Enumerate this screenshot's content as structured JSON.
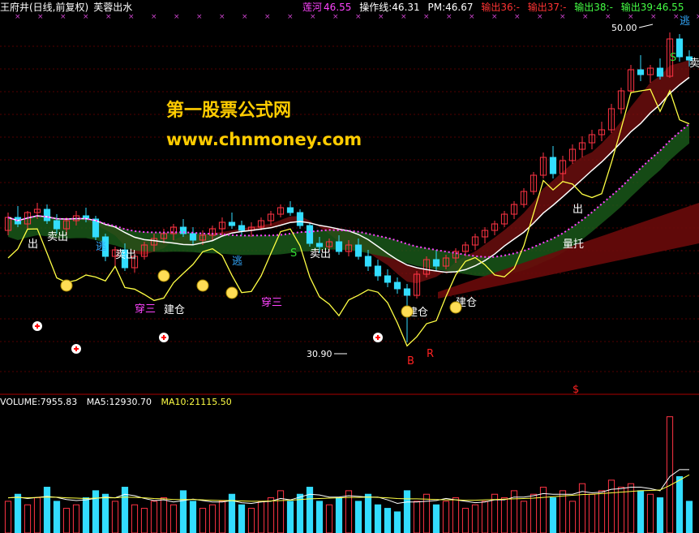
{
  "header": {
    "title": "王府井(日线,前复权)",
    "indicator": "芙蓉出水",
    "l1_name": "莲河",
    "l1_val": "46.55",
    "l2_name": "操作线",
    "l2_val": "46.31",
    "l3_name": "PM",
    "l3_val": "46.67",
    "l4": "输出36:-",
    "l5": "输出37:-",
    "l6": "输出38:-",
    "l7_name": "输出39",
    "l7_val": "46.55"
  },
  "watermark": {
    "line1": "第一股票公式网",
    "line2": "www.chnmoney.com"
  },
  "volume_panel": {
    "vol_label": "VOLUME:7955.83",
    "ma5_label": "MA5:12930.70",
    "ma10_label": "MA10:21115.50"
  },
  "colors": {
    "up": "#ff3344",
    "down": "#33ddff",
    "white_line": "#ffffff",
    "yellow_line": "#ffff44",
    "green_band": "#1a5c1a",
    "red_band": "#7a1010",
    "magenta_dots": "#ff44ff",
    "vol_ma": "#ffffff"
  },
  "chart_data": [
    {
      "type": "candlestick",
      "title": "王府井(日线,前复权)",
      "price_labels": {
        "high": "50.00",
        "low": "30.90"
      },
      "annotations": [
        "出",
        "卖出",
        "逃",
        "卖出",
        "穿三",
        "建仓",
        "逃",
        "穿三",
        "S",
        "卖出",
        "建仓",
        "建仓",
        "B",
        "R",
        "出",
        "量托",
        "逃",
        "卖出",
        "S",
        "$"
      ],
      "candles": [
        [
          37.8,
          38.9,
          37.5,
          38.6
        ],
        [
          38.6,
          39.3,
          38.0,
          38.2
        ],
        [
          38.2,
          39.0,
          37.9,
          38.9
        ],
        [
          38.9,
          39.5,
          38.5,
          39.1
        ],
        [
          39.1,
          39.4,
          38.2,
          38.4
        ],
        [
          38.4,
          38.8,
          37.6,
          37.9
        ],
        [
          37.9,
          38.6,
          37.5,
          38.4
        ],
        [
          38.4,
          39.0,
          38.1,
          38.7
        ],
        [
          38.7,
          39.2,
          38.3,
          38.5
        ],
        [
          38.5,
          38.7,
          37.2,
          37.4
        ],
        [
          37.4,
          37.6,
          35.9,
          36.2
        ],
        [
          36.2,
          36.8,
          35.5,
          36.6
        ],
        [
          36.6,
          37.0,
          35.3,
          35.5
        ],
        [
          35.5,
          36.4,
          35.2,
          36.2
        ],
        [
          36.2,
          37.1,
          36.0,
          36.9
        ],
        [
          36.9,
          37.6,
          36.5,
          37.3
        ],
        [
          37.3,
          37.9,
          37.0,
          37.6
        ],
        [
          37.6,
          38.2,
          37.2,
          38.0
        ],
        [
          38.0,
          38.5,
          37.4,
          37.6
        ],
        [
          37.6,
          38.0,
          36.9,
          37.2
        ],
        [
          37.2,
          37.8,
          36.9,
          37.5
        ],
        [
          37.5,
          38.1,
          37.2,
          37.9
        ],
        [
          37.9,
          38.6,
          37.5,
          38.3
        ],
        [
          38.3,
          38.9,
          37.9,
          38.1
        ],
        [
          38.1,
          38.4,
          37.5,
          37.8
        ],
        [
          37.8,
          38.3,
          37.4,
          38.0
        ],
        [
          38.0,
          38.6,
          37.8,
          38.4
        ],
        [
          38.4,
          39.0,
          38.1,
          38.8
        ],
        [
          38.8,
          39.4,
          38.6,
          39.2
        ],
        [
          39.2,
          39.6,
          38.7,
          38.9
        ],
        [
          38.9,
          39.1,
          37.9,
          38.1
        ],
        [
          38.1,
          38.3,
          36.8,
          37.0
        ],
        [
          37.0,
          37.4,
          36.4,
          36.8
        ],
        [
          36.8,
          37.3,
          36.5,
          37.1
        ],
        [
          37.1,
          37.5,
          36.3,
          36.5
        ],
        [
          36.5,
          37.2,
          36.2,
          36.9
        ],
        [
          36.9,
          37.3,
          36.0,
          36.2
        ],
        [
          36.2,
          36.6,
          35.3,
          35.6
        ],
        [
          35.6,
          36.0,
          34.7,
          35.0
        ],
        [
          35.0,
          35.4,
          34.3,
          34.6
        ],
        [
          34.6,
          34.9,
          33.9,
          34.2
        ],
        [
          34.2,
          34.5,
          30.9,
          33.8
        ],
        [
          33.8,
          35.3,
          33.6,
          35.1
        ],
        [
          35.1,
          36.2,
          34.9,
          36.0
        ],
        [
          36.0,
          36.6,
          35.3,
          35.6
        ],
        [
          35.6,
          36.3,
          35.4,
          36.1
        ],
        [
          36.1,
          36.7,
          35.8,
          36.5
        ],
        [
          36.5,
          37.1,
          36.2,
          36.9
        ],
        [
          36.9,
          37.6,
          36.6,
          37.4
        ],
        [
          37.4,
          38.0,
          37.0,
          37.8
        ],
        [
          37.8,
          38.4,
          37.5,
          38.2
        ],
        [
          38.2,
          39.0,
          38.0,
          38.8
        ],
        [
          38.8,
          39.6,
          38.5,
          39.4
        ],
        [
          39.4,
          40.4,
          39.2,
          40.2
        ],
        [
          40.2,
          41.4,
          40.0,
          41.2
        ],
        [
          41.2,
          42.6,
          41.0,
          42.3
        ],
        [
          42.3,
          43.0,
          41.0,
          41.3
        ],
        [
          41.3,
          42.4,
          40.8,
          42.1
        ],
        [
          42.1,
          43.1,
          41.9,
          42.8
        ],
        [
          42.8,
          43.6,
          42.3,
          43.2
        ],
        [
          43.2,
          44.0,
          42.8,
          43.7
        ],
        [
          43.7,
          44.5,
          43.3,
          44.0
        ],
        [
          44.0,
          45.6,
          43.8,
          45.3
        ],
        [
          45.3,
          46.6,
          45.0,
          46.4
        ],
        [
          46.4,
          48.0,
          46.2,
          47.7
        ],
        [
          47.7,
          48.6,
          47.0,
          47.4
        ],
        [
          47.4,
          48.0,
          46.9,
          47.8
        ],
        [
          47.8,
          48.4,
          47.1,
          47.3
        ],
        [
          47.3,
          50.0,
          47.2,
          49.6
        ],
        [
          49.6,
          49.9,
          48.2,
          48.5
        ],
        [
          48.5,
          48.9,
          47.9,
          48.3
        ]
      ],
      "volume": {
        "max": 35000,
        "values": [
          9000,
          11000,
          8000,
          10000,
          13000,
          9000,
          7000,
          8000,
          10000,
          12000,
          11000,
          9000,
          13000,
          8000,
          7000,
          9000,
          10000,
          8000,
          12000,
          9000,
          7000,
          8000,
          9000,
          11000,
          8000,
          7000,
          9000,
          10000,
          12000,
          9000,
          11000,
          13000,
          9000,
          8000,
          10000,
          12000,
          9000,
          11000,
          8000,
          7000,
          6000,
          12000,
          9000,
          11000,
          8000,
          9000,
          10000,
          7000,
          8000,
          9000,
          11000,
          10000,
          12000,
          9000,
          11000,
          13000,
          10000,
          12000,
          9000,
          14000,
          11000,
          12000,
          15000,
          13000,
          14000,
          12000,
          11000,
          10000,
          33000,
          16000,
          9000
        ],
        "ma5": [
          10000,
          10200,
          9800,
          10100,
          10400,
          10100,
          9500,
          9200,
          9400,
          9800,
          10200,
          10000,
          11000,
          10600,
          9800,
          9200,
          9400,
          8800,
          9200,
          9600,
          9200,
          8800,
          8800,
          9200,
          8600,
          8400,
          8800,
          9000,
          9800,
          9400,
          10200,
          11000,
          10800,
          10200,
          10200,
          10600,
          10400,
          10200,
          10200,
          9400,
          8400,
          8800,
          8800,
          9000,
          9200,
          9800,
          9400,
          9000,
          8600,
          8800,
          9400,
          9400,
          10200,
          10200,
          10600,
          11200,
          11000,
          11000,
          11000,
          11800,
          11400,
          11600,
          12400,
          12600,
          13000,
          13000,
          12600,
          12000,
          16000,
          18000,
          18000
        ],
        "ma10": [
          10000,
          10100,
          10000,
          10100,
          10200,
          10150,
          10000,
          9900,
          9800,
          9900,
          10000,
          10000,
          10200,
          10100,
          10000,
          9800,
          9700,
          9500,
          9500,
          9500,
          9400,
          9300,
          9200,
          9200,
          9100,
          9000,
          9000,
          9100,
          9200,
          9300,
          9500,
          9700,
          9800,
          9900,
          10000,
          10100,
          10100,
          10200,
          10100,
          10000,
          9800,
          9700,
          9700,
          9600,
          9500,
          9400,
          9400,
          9300,
          9300,
          9400,
          9500,
          9600,
          9700,
          9800,
          9900,
          10100,
          10300,
          10500,
          10700,
          10900,
          11000,
          11200,
          11400,
          11600,
          11800,
          12000,
          12100,
          12200,
          13500,
          15000,
          16500
        ]
      }
    }
  ]
}
